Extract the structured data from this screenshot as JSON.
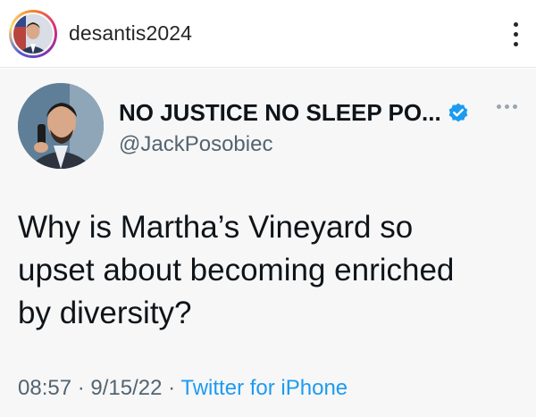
{
  "post": {
    "username": "desantis2024",
    "more_icon": "vertical-ellipsis-icon"
  },
  "tweet": {
    "display_name": "NO JUSTICE NO SLEEP PO...",
    "handle": "@JackPosobiec",
    "verified_icon": "verified-badge-icon",
    "verified_color": "#1d9bf0",
    "text": "Why is Martha’s Vineyard so\nupset about becoming enriched\nby diversity?",
    "time": "08:57",
    "separator": "·",
    "date": "9/15/22",
    "source": "Twitter for iPhone",
    "source_color": "#1d9bf0"
  }
}
